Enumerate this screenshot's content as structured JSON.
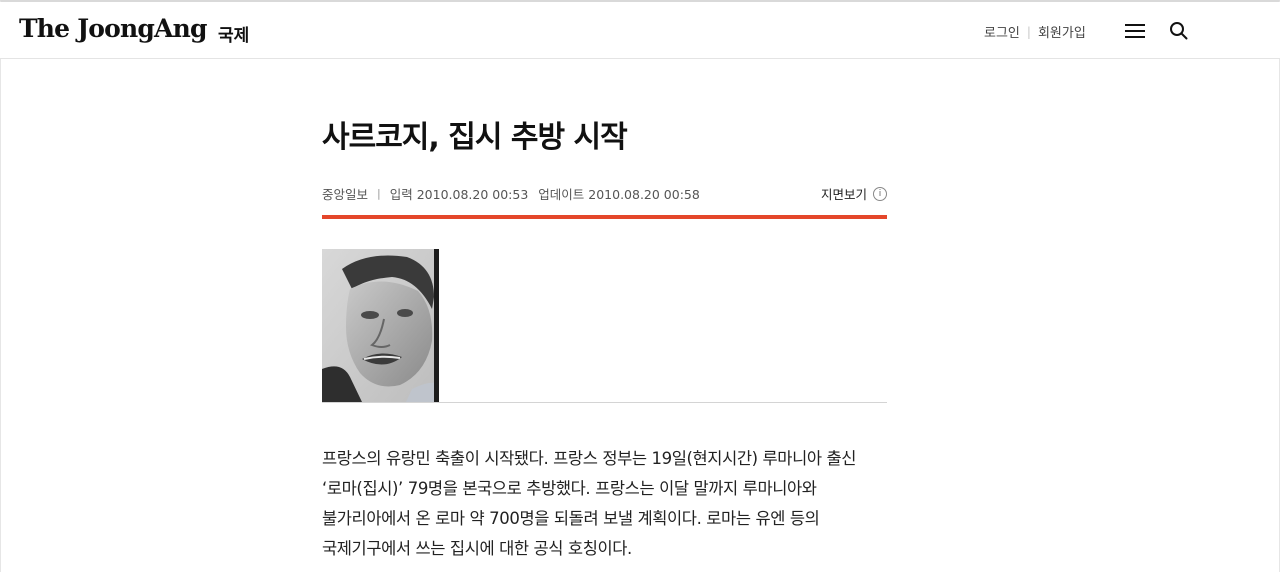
{
  "header": {
    "logo": "The JoongAng",
    "section": "국제",
    "login": "로그인",
    "signup": "회원가입",
    "menu_icon": "hamburger-menu-icon",
    "search_icon": "search-icon"
  },
  "article": {
    "title": "사르코지, 집시 추방 시작",
    "source": "중앙일보",
    "published": "입력 2010.08.20 00:53",
    "updated": "업데이트 2010.08.20 00:58",
    "paper_view": "지면보기",
    "paper_info_icon": "info-icon",
    "body_lines": [
      "프랑스의 유랑민 축출이 시작됐다. 프랑스 정부는 19일(현지시간) 루마니아 출신",
      "‘로마(집시)’ 79명을 본국으로 추방했다. 프랑스는 이달 말까지 루마니아와",
      "불가리아에서 온 로마 약 700명을 되돌려 보낼 계획이다. 로마는 유엔 등의",
      "국제기구에서 쓰는 집시에 대한 공식 호칭이다."
    ]
  },
  "colors": {
    "accent_red": "#e4462a",
    "text": "#111111"
  }
}
